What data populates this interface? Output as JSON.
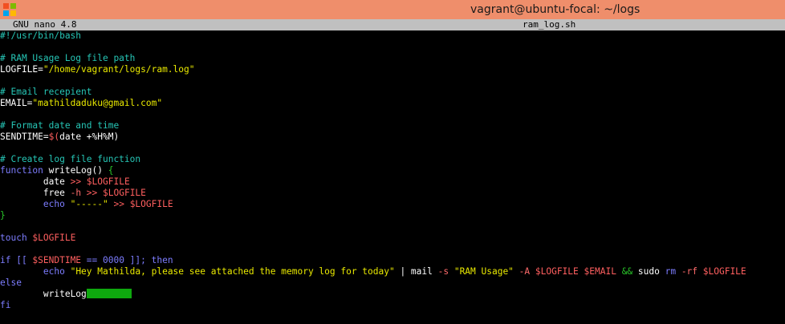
{
  "window": {
    "title": "vagrant@ubuntu-focal: ~/logs"
  },
  "nano": {
    "version": "GNU nano 4.8",
    "filename": "ram_log.sh"
  },
  "code": {
    "l01": "#!/usr/bin/bash",
    "l03": "# RAM Usage Log file path",
    "l04_a": "LOGFILE=",
    "l04_b": "\"/home/vagrant/logs/ram.log\"",
    "l06": "# Email recepient",
    "l07_a": "EMAIL=",
    "l07_b": "\"mathildaduku@gmail.com\"",
    "l09": "# Format date and time",
    "l10_a": "SENDTIME=",
    "l10_b": "$(",
    "l10_c": "date +%H%M)",
    "l12": "# Create log file function",
    "l13_a": "function",
    "l13_b": " writeLog() ",
    "l13_c": "{",
    "l14_indent": "        ",
    "l14_a": "date ",
    "l14_b": ">> ",
    "l14_c": "$LOGFILE",
    "l15_a": "free ",
    "l15_b": "-h ",
    "l15_c": ">> ",
    "l15_d": "$LOGFILE",
    "l16_a": "echo ",
    "l16_b": "\"-----\"",
    "l16_c": " >> ",
    "l16_d": "$LOGFILE",
    "l17": "}",
    "l19_a": "touch ",
    "l19_b": "$LOGFILE",
    "l21_a": "if [[ ",
    "l21_b": "$SENDTIME",
    "l21_c": " == 0000 ]]; ",
    "l21_d": "then",
    "l22_a": "echo ",
    "l22_b": "\"Hey Mathilda, please see attached the memory log for today\"",
    "l22_c": " | mail ",
    "l22_d": "-s ",
    "l22_e": "\"RAM Usage\"",
    "l22_f": " -A ",
    "l22_g": "$LOGFILE",
    "l22_h": " ",
    "l22_i": "$EMAIL",
    "l22_j": " ",
    "l22_k": "&&",
    "l22_l": " sudo ",
    "l22_m": "rm ",
    "l22_n": "-rf ",
    "l22_o": "$LOGFILE",
    "l23": "else",
    "l24": "writeLog",
    "l25": "fi"
  },
  "colors": {
    "titlebar": "#ef8e6b",
    "header_bg": "#c0c0c0",
    "comment": "#26c6b6",
    "keyword": "#7d7dff",
    "string": "#e9e900",
    "variable": "#ff5f5f",
    "selection": "#0ea80e"
  },
  "icons": {
    "app_icon": "terminal-app-icon"
  }
}
